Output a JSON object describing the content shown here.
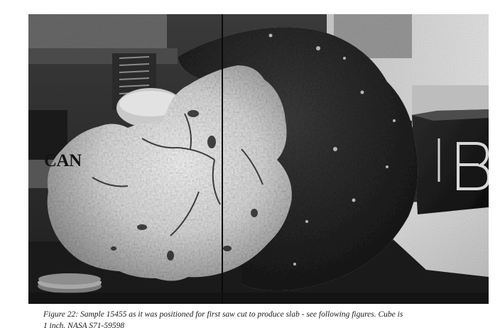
{
  "figure": {
    "photo_label": "CAN",
    "caption_line1": "Figure 22:  Sample 15455 as it was positioned for first saw cut to produce slab - see following figures.  Cube is",
    "caption_line2": "1 inch.   NASA S71-59598"
  }
}
